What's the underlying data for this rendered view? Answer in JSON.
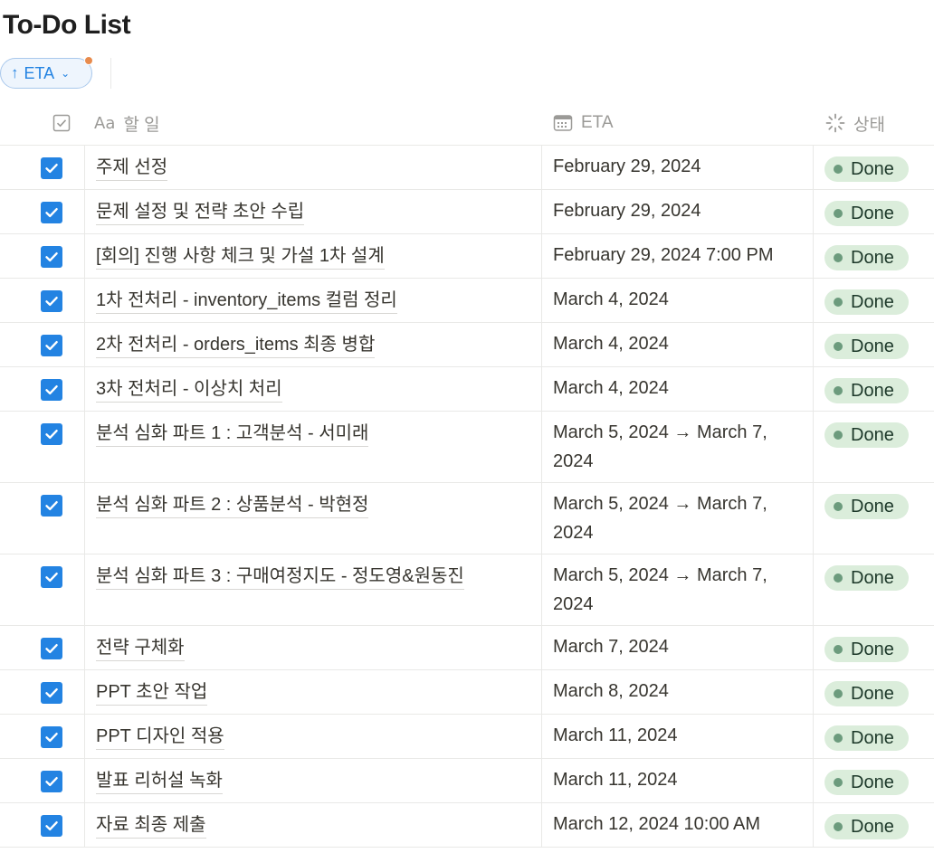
{
  "page": {
    "title": "To-Do List"
  },
  "sort": {
    "label": "ETA",
    "arrow": "↑",
    "chevron": "⌄"
  },
  "columns": {
    "task": "할 일",
    "task_icon": "Aa",
    "eta": "ETA",
    "status": "상태"
  },
  "colors": {
    "accent": "#2383e2",
    "done_bg": "#dbeddb",
    "done_dot": "#6c9b7d",
    "sort_dot": "#e88b4d"
  },
  "rows": [
    {
      "task": "주제 선정",
      "eta": "February 29, 2024",
      "status": "Done",
      "checked": true
    },
    {
      "task": "문제 설정 및 전략 초안 수립",
      "eta": "February 29, 2024",
      "status": "Done",
      "checked": true
    },
    {
      "task": "[회의] 진행 사항 체크 및 가설 1차 설계",
      "eta": "February 29, 2024 7:00 PM",
      "status": "Done",
      "checked": true
    },
    {
      "task": "1차 전처리 - inventory_items 컬럼 정리",
      "eta": "March 4, 2024",
      "status": "Done",
      "checked": true
    },
    {
      "task": "2차 전처리 - orders_items 최종 병합",
      "eta": "March 4, 2024",
      "status": "Done",
      "checked": true
    },
    {
      "task": "3차 전처리 - 이상치 처리",
      "eta": "March 4, 2024",
      "status": "Done",
      "checked": true
    },
    {
      "task": "분석 심화 파트 1 : 고객분석 - 서미래",
      "eta": "March 5, 2024 → March 7, 2024",
      "status": "Done",
      "checked": true
    },
    {
      "task": "분석 심화 파트 2 : 상품분석 - 박현정",
      "eta": "March 5, 2024 → March 7, 2024",
      "status": "Done",
      "checked": true
    },
    {
      "task": "분석 심화 파트 3 : 구매여정지도 - 정도영&원동진",
      "eta": "March 5, 2024 → March 7, 2024",
      "status": "Done",
      "checked": true
    },
    {
      "task": "전략 구체화",
      "eta": "March 7, 2024",
      "status": "Done",
      "checked": true
    },
    {
      "task": "PPT 초안 작업",
      "eta": "March 8, 2024",
      "status": "Done",
      "checked": true
    },
    {
      "task": "PPT 디자인 적용",
      "eta": "March 11, 2024",
      "status": "Done",
      "checked": true
    },
    {
      "task": "발표 리허설 녹화",
      "eta": "March 11, 2024",
      "status": "Done",
      "checked": true
    },
    {
      "task": "자료 최종 제출",
      "eta": "March 12, 2024 10:00 AM",
      "status": "Done",
      "checked": true
    }
  ]
}
